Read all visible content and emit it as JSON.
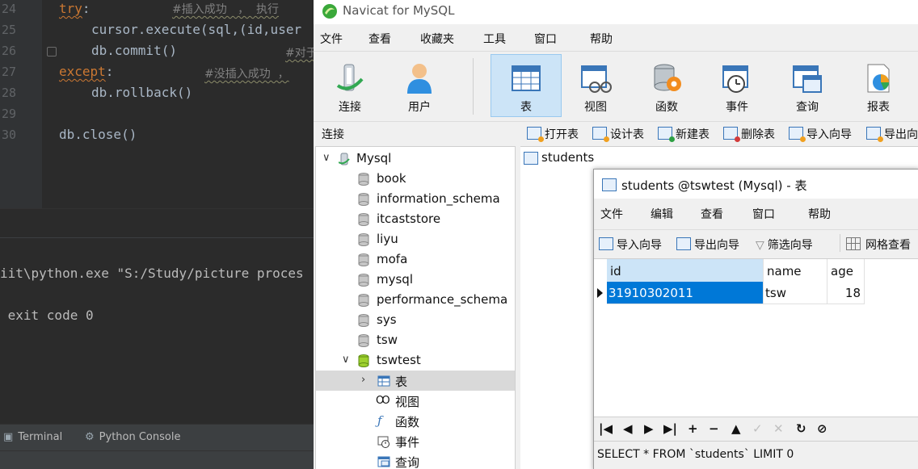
{
  "ide": {
    "lines": [
      {
        "num": "24",
        "kw": "try",
        "rest": ":",
        "comment": "#插入成功   ，  执行"
      },
      {
        "num": "25",
        "code": "cursor.execute(sql,(id,user"
      },
      {
        "num": "26",
        "code": "db.commit()",
        "comment": "#对于"
      },
      {
        "num": "27",
        "kw": "except",
        "rest": ":",
        "comment": "#没插入成功  ，"
      },
      {
        "num": "28",
        "code": "db.rollback()"
      },
      {
        "num": "29",
        "code": ""
      },
      {
        "num": "30",
        "code": "db.close()"
      }
    ],
    "console": {
      "line1": "iit\\python.exe \"S:/Study/picture proces",
      "line2": " exit code 0"
    },
    "tabs": {
      "terminal": "Terminal",
      "python_console": "Python Console"
    }
  },
  "navicat": {
    "title": "Navicat for MySQL",
    "menu": [
      "文件",
      "查看",
      "收藏夹",
      "工具",
      "窗口",
      "帮助"
    ],
    "toolbar": {
      "connect": "连接",
      "user": "用户",
      "table": "表",
      "view": "视图",
      "function": "函数",
      "event": "事件",
      "query": "查询",
      "report": "报表"
    },
    "connections_header": "连接",
    "object_bar": [
      "打开表",
      "设计表",
      "新建表",
      "删除表",
      "导入向导",
      "导出向"
    ],
    "tree": {
      "root": "Mysql",
      "databases": [
        "book",
        "information_schema",
        "itcaststore",
        "liyu",
        "mofa",
        "mysql",
        "performance_schema",
        "sys",
        "tsw",
        "tswtest"
      ],
      "children": {
        "table": "表",
        "view": "视图",
        "function": "函数",
        "event": "事件",
        "query": "查询"
      }
    },
    "object_item": "students",
    "table_window": {
      "title": "students @tswtest (Mysql) - 表",
      "menu": [
        "文件",
        "编辑",
        "查看",
        "窗口",
        "帮助"
      ],
      "tools": {
        "import": "导入向导",
        "export": "导出向导",
        "filter": "筛选向导",
        "grid": "网格查看"
      },
      "columns": [
        "id",
        "name",
        "age"
      ],
      "row": {
        "id": "31910302011",
        "name": "tsw",
        "age": "18"
      },
      "sql": "SELECT * FROM `students` LIMIT 0"
    }
  }
}
